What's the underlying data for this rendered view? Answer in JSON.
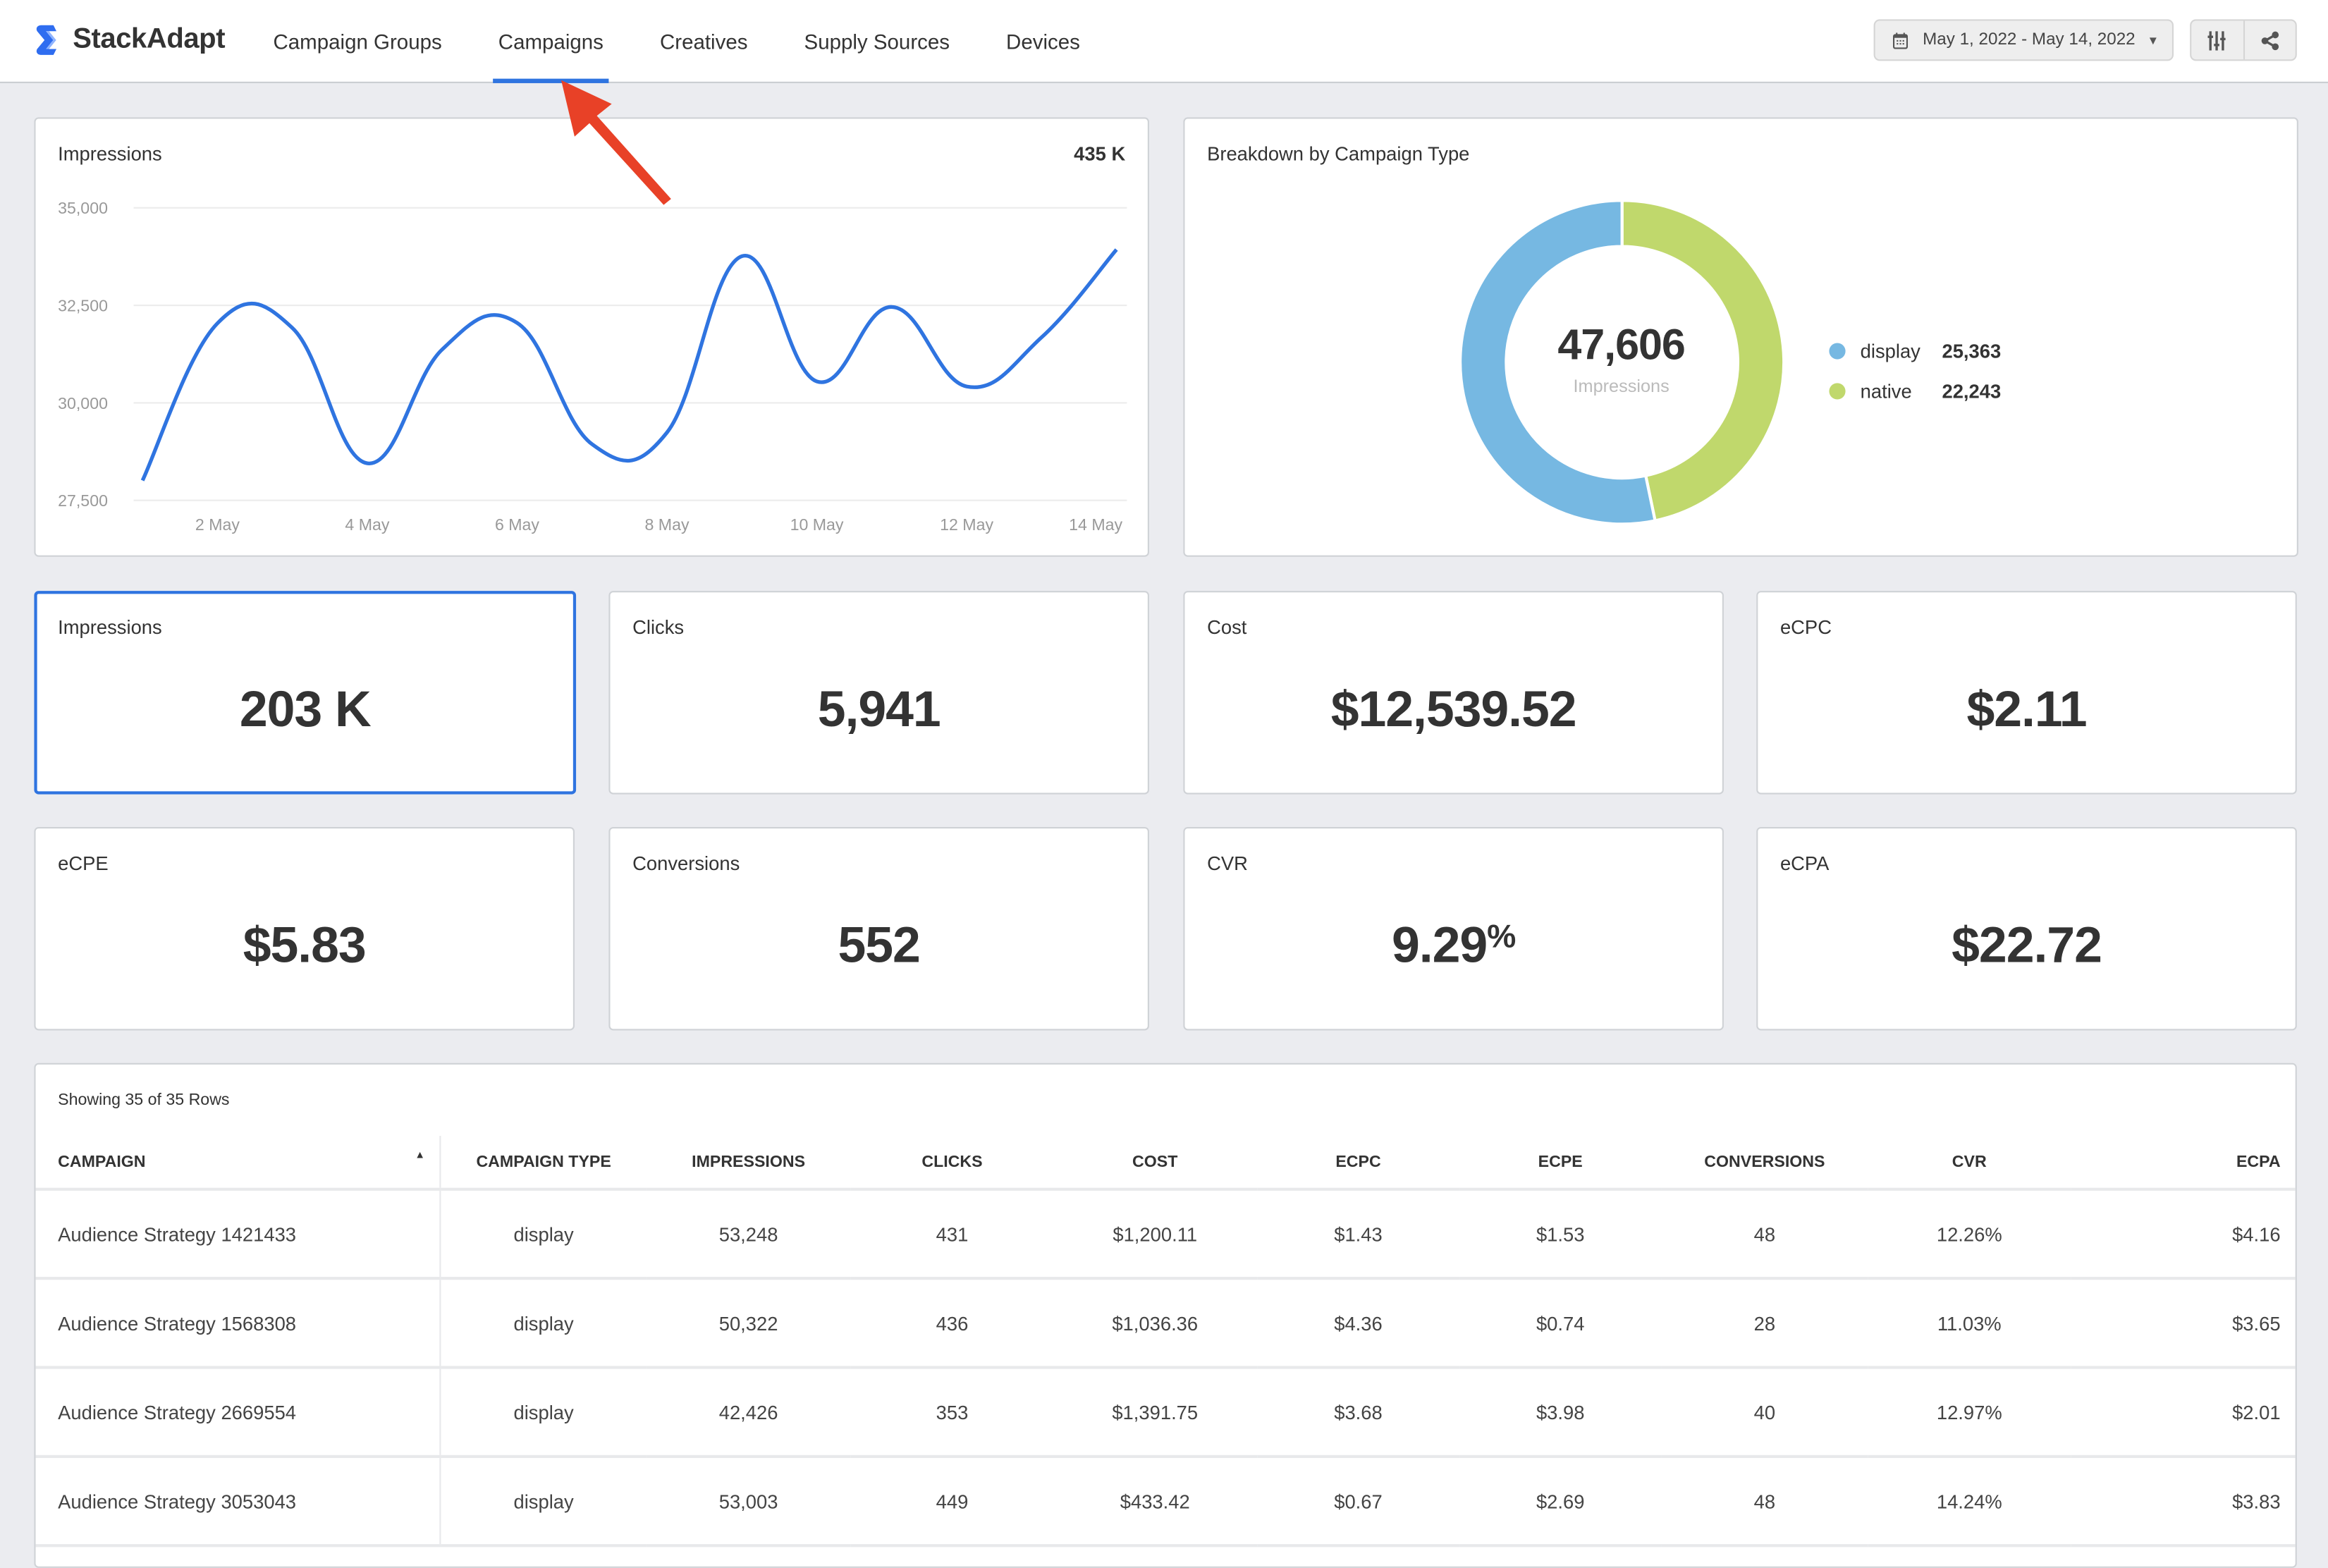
{
  "brand": {
    "name": "StackAdapt",
    "accent_color": "#2f74e0",
    "logo_icon": "stackadapt-s-logo-icon"
  },
  "nav": {
    "items": [
      {
        "label": "Campaign Groups",
        "active": false
      },
      {
        "label": "Campaigns",
        "active": true
      },
      {
        "label": "Creatives",
        "active": false
      },
      {
        "label": "Supply Sources",
        "active": false
      },
      {
        "label": "Devices",
        "active": false
      }
    ]
  },
  "toolbar": {
    "date_range": "May 1, 2022 - May 14, 2022",
    "date_icon": "calendar-icon",
    "date_caret_icon": "caret-down-icon",
    "settings_icon": "sliders-icon",
    "share_icon": "share-icon"
  },
  "annotation": {
    "arrow_color": "#e84127",
    "points_to": "Campaigns"
  },
  "impressions_chart": {
    "title": "Impressions",
    "total": "435 K"
  },
  "breakdown": {
    "title": "Breakdown by Campaign Type",
    "center_value": "47,606",
    "center_label": "Impressions"
  },
  "chart_data": [
    {
      "type": "line",
      "title": "Impressions",
      "annotation": "435 K",
      "x": [
        "1 May",
        "2 May",
        "3 May",
        "4 May",
        "5 May",
        "6 May",
        "7 May",
        "8 May",
        "9 May",
        "10 May",
        "11 May",
        "12 May",
        "13 May",
        "14 May"
      ],
      "series": [
        {
          "name": "Impressions",
          "color": "#2f74e0",
          "values": [
            28010,
            32040,
            31920,
            28450,
            31370,
            32050,
            28940,
            29240,
            33760,
            30550,
            32460,
            30420,
            31680,
            33930
          ]
        }
      ],
      "xticks": [
        "2 May",
        "4 May",
        "6 May",
        "8 May",
        "10 May",
        "12 May",
        "14 May"
      ],
      "yticks": [
        "27,500",
        "30,000",
        "32,500",
        "35,000"
      ],
      "ylim": [
        27500,
        35000
      ],
      "xlabel": "",
      "ylabel": "",
      "grid": true,
      "legend": "none"
    },
    {
      "type": "pie",
      "title": "Breakdown by Campaign Type",
      "center_value": "47,606",
      "center_label": "Impressions",
      "categories": [
        "display",
        "native"
      ],
      "values": [
        25363,
        22243
      ],
      "value_labels": [
        "25,363",
        "22,243"
      ],
      "colors": [
        "#76b8e2",
        "#c0d86c"
      ],
      "legend": "right"
    }
  ],
  "kpis": [
    {
      "label": "Impressions",
      "value": "203 K",
      "selected": true
    },
    {
      "label": "Clicks",
      "value": "5,941",
      "selected": false
    },
    {
      "label": "Cost",
      "value": "$12,539.52",
      "selected": false
    },
    {
      "label": "eCPC",
      "value": "$2.11",
      "selected": false
    },
    {
      "label": "eCPE",
      "value": "$5.83",
      "selected": false
    },
    {
      "label": "Conversions",
      "value": "552",
      "selected": false
    },
    {
      "label": "CVR",
      "value": "9.29",
      "unit": "%",
      "selected": false
    },
    {
      "label": "eCPA",
      "value": "$22.72",
      "selected": false
    }
  ],
  "table": {
    "caption": "Showing 35 of 35 Rows",
    "sort_icon": "sort-ascending-icon",
    "columns": [
      "Campaign",
      "Campaign Type",
      "Impressions",
      "Clicks",
      "Cost",
      "eCPC",
      "eCPE",
      "Conversions",
      "CVR",
      "eCPA"
    ],
    "rows": [
      [
        "Audience Strategy 1421433",
        "display",
        "53,248",
        "431",
        "$1,200.11",
        "$1.43",
        "$1.53",
        "48",
        "12.26%",
        "$4.16"
      ],
      [
        "Audience Strategy 1568308",
        "display",
        "50,322",
        "436",
        "$1,036.36",
        "$4.36",
        "$0.74",
        "28",
        "11.03%",
        "$3.65"
      ],
      [
        "Audience Strategy 2669554",
        "display",
        "42,426",
        "353",
        "$1,391.75",
        "$3.68",
        "$3.98",
        "40",
        "12.97%",
        "$2.01"
      ],
      [
        "Audience Strategy 3053043",
        "display",
        "53,003",
        "449",
        "$433.42",
        "$0.67",
        "$2.69",
        "48",
        "14.24%",
        "$3.83"
      ]
    ]
  }
}
